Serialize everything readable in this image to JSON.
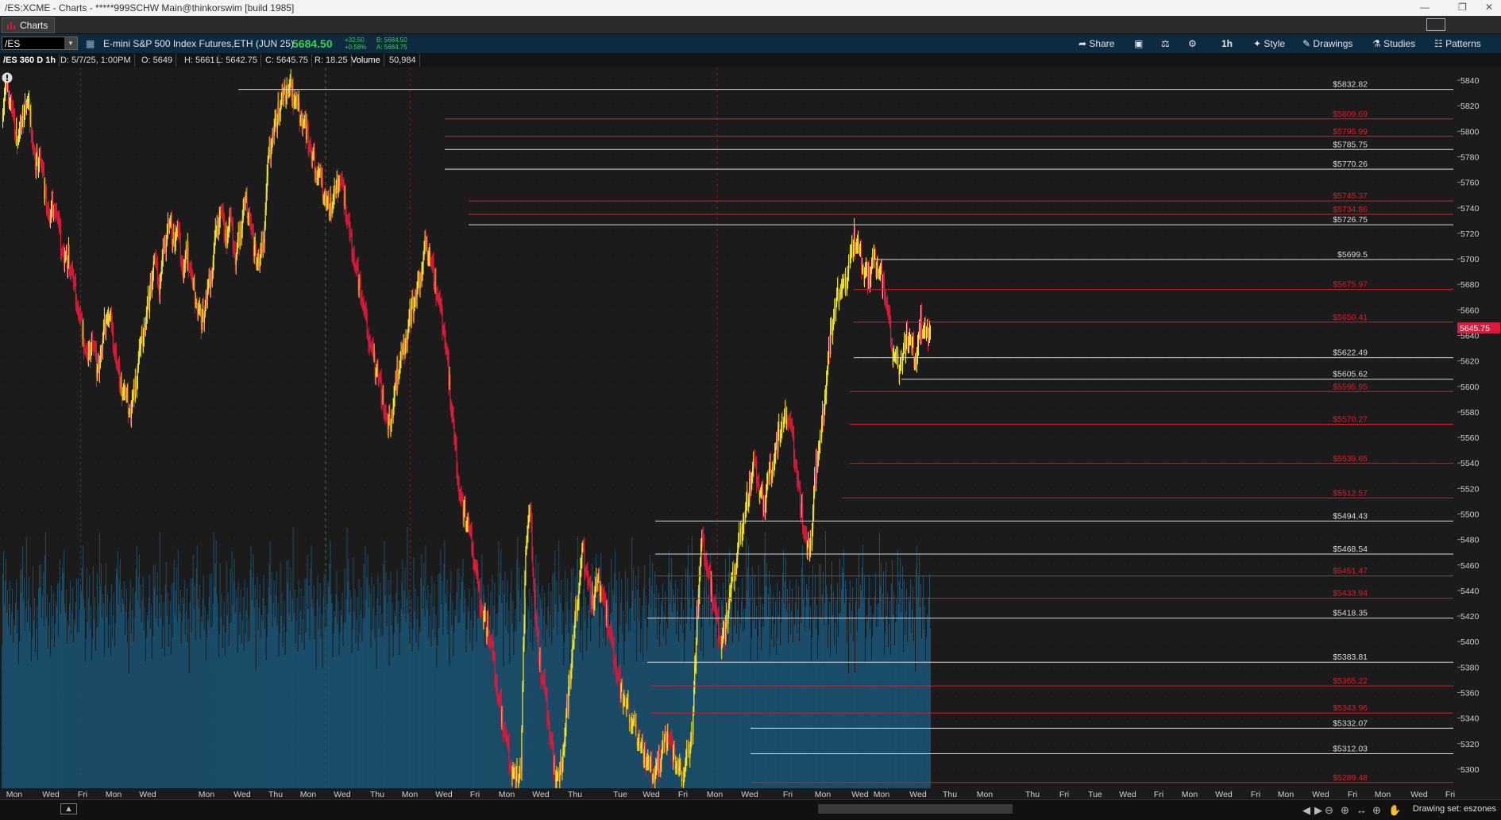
{
  "window": {
    "title": "/ES:XCME - Charts - *****999SCHW Main@thinkorswim [build 1985]"
  },
  "tab": {
    "label": "Charts"
  },
  "toolbar": {
    "symbol": "/ES",
    "description": "E-mini S&P 500 Index Futures,ETH (JUN 25)",
    "last": "5684.50",
    "change": "+32.50",
    "change_pct": "+0.58%",
    "bid": "B: 5684.50",
    "ask": "A: 5684.75",
    "buttons": {
      "share": "Share",
      "interval": "1h",
      "style": "Style",
      "drawings": "Drawings",
      "studies": "Studies",
      "patterns": "Patterns"
    }
  },
  "infobar": {
    "name": "/ES 360 D 1h",
    "date": "D: 5/7/25, 1:00PM",
    "open": "O: 5649",
    "high": "H: 5661",
    "low": "L: 5642.75",
    "close": "C: 5645.75",
    "range": "R: 18.25",
    "volume_label": "Volume",
    "volume_value": "50,984"
  },
  "bottom": {
    "drawing_set": "Drawing set: eszones"
  },
  "colors": {
    "up": "#f2e92a",
    "down": "#e0183a",
    "volume": "#1a5a7e",
    "level_white": "#d8d8d8",
    "level_red": "#d2202c",
    "background": "#1b1b1b",
    "current_price": "#e0183a"
  },
  "chart_data": {
    "type": "candlestick",
    "symbol": "/ES",
    "interval": "1h",
    "ylim": [
      5285,
      5850
    ],
    "y_ticks": [
      5300,
      5320,
      5340,
      5360,
      5380,
      5400,
      5420,
      5440,
      5460,
      5480,
      5500,
      5520,
      5540,
      5560,
      5580,
      5600,
      5620,
      5640,
      5660,
      5680,
      5700,
      5720,
      5740,
      5760,
      5780,
      5800,
      5820,
      5840
    ],
    "x_labels": [
      "Mon",
      "Wed",
      "Fri",
      "Mon",
      "Wed",
      "Mon",
      "Wed",
      "Thu",
      "Mon",
      "Wed",
      "Thu",
      "Mon",
      "Wed",
      "Fri",
      "Mon",
      "Wed",
      "Thu",
      "Tue",
      "Wed",
      "Fri",
      "Mon",
      "Wed",
      "Fri",
      "Mon",
      "Wed",
      "Mon",
      "Wed",
      "Thu",
      "Mon",
      "Thu",
      "Fri",
      "Tue",
      "Wed",
      "Fri",
      "Mon",
      "Wed",
      "Fri",
      "Mon",
      "Wed",
      "Fri",
      "Mon",
      "Wed",
      "Fri"
    ],
    "current_price": "5645.75",
    "price_levels": [
      {
        "value": 5832.82,
        "label": "$5832.82",
        "color": "white"
      },
      {
        "value": 5809.69,
        "label": "$5809.69",
        "color": "red"
      },
      {
        "value": 5795.99,
        "label": "$5795.99",
        "color": "red"
      },
      {
        "value": 5785.75,
        "label": "$5785.75",
        "color": "white"
      },
      {
        "value": 5770.26,
        "label": "$5770.26",
        "color": "white"
      },
      {
        "value": 5745.37,
        "label": "$5745.37",
        "color": "red"
      },
      {
        "value": 5734.86,
        "label": "$5734.86",
        "color": "red"
      },
      {
        "value": 5726.75,
        "label": "$5726.75",
        "color": "white"
      },
      {
        "value": 5699.5,
        "label": "$5699.5",
        "color": "white"
      },
      {
        "value": 5675.97,
        "label": "$5675.97",
        "color": "red"
      },
      {
        "value": 5650.41,
        "label": "$5650.41",
        "color": "red"
      },
      {
        "value": 5622.49,
        "label": "$5622.49",
        "color": "white"
      },
      {
        "value": 5605.62,
        "label": "$5605.62",
        "color": "white"
      },
      {
        "value": 5595.95,
        "label": "$5595.95",
        "color": "red"
      },
      {
        "value": 5570.27,
        "label": "$5570.27",
        "color": "red"
      },
      {
        "value": 5539.65,
        "label": "$5539.65",
        "color": "red"
      },
      {
        "value": 5512.57,
        "label": "$5512.57",
        "color": "red"
      },
      {
        "value": 5494.43,
        "label": "$5494.43",
        "color": "white"
      },
      {
        "value": 5468.54,
        "label": "$5468.54",
        "color": "white"
      },
      {
        "value": 5451.47,
        "label": "$5451.47",
        "color": "red"
      },
      {
        "value": 5433.94,
        "label": "$5433.94",
        "color": "red"
      },
      {
        "value": 5418.35,
        "label": "$5418.35",
        "color": "white"
      },
      {
        "value": 5383.81,
        "label": "$5383.81",
        "color": "white"
      },
      {
        "value": 5365.22,
        "label": "$5365.22",
        "color": "red"
      },
      {
        "value": 5343.96,
        "label": "$5343.96",
        "color": "red"
      },
      {
        "value": 5332.07,
        "label": "$5332.07",
        "color": "white"
      },
      {
        "value": 5312.03,
        "label": "$5312.03",
        "color": "white"
      },
      {
        "value": 5289.48,
        "label": "$5289.48",
        "color": "red"
      }
    ],
    "price_path": [
      [
        5815,
        5835,
        5820,
        5795,
        5800,
        5825,
        5810,
        5770,
        5785,
        5750,
        5730,
        5745,
        5720,
        5700
      ],
      [
        5700,
        5680,
        5660,
        5640,
        5620,
        5640,
        5610,
        5630,
        5660,
        5645,
        5620,
        5600,
        5590,
        5580
      ],
      [
        5600,
        5630,
        5650,
        5670,
        5700,
        5680,
        5705,
        5730,
        5715,
        5720,
        5690,
        5705,
        5680,
        5665
      ],
      [
        5650,
        5670,
        5690,
        5720,
        5740,
        5715,
        5730,
        5700,
        5720,
        5745,
        5735,
        5705,
        5695,
        5720
      ],
      [
        5780,
        5800,
        5815,
        5825,
        5835,
        5830,
        5820,
        5810,
        5800,
        5780,
        5770,
        5760,
        5745,
        5740
      ],
      [
        5750,
        5765,
        5745,
        5720,
        5700,
        5680,
        5660,
        5640,
        5620,
        5610,
        5590,
        5565,
        5580,
        5610
      ],
      [
        5625,
        5640,
        5660,
        5670,
        5690,
        5710,
        5700,
        5680,
        5660,
        5640,
        5600,
        5560,
        5520,
        5500
      ],
      [
        5490,
        5470,
        5440,
        5420,
        5410,
        5390,
        5360,
        5340,
        5320,
        5300,
        5290,
        5300,
        5480,
        5500
      ],
      [
        5420,
        5380,
        5360,
        5330,
        5300,
        5290,
        5320,
        5360,
        5400,
        5440,
        5470,
        5450,
        5430,
        5445
      ],
      [
        5440,
        5420,
        5400,
        5380,
        5360,
        5350,
        5340,
        5330,
        5320,
        5310,
        5300,
        5295,
        5305,
        5320
      ],
      [
        5330,
        5310,
        5300,
        5295,
        5310,
        5330,
        5420,
        5480,
        5460,
        5440,
        5420,
        5400,
        5410,
        5440
      ],
      [
        5460,
        5480,
        5500,
        5520,
        5540,
        5520,
        5505,
        5530,
        5540,
        5560,
        5570,
        5580,
        5560,
        5530
      ],
      [
        5500,
        5470,
        5480,
        5540,
        5560,
        5600,
        5640,
        5660,
        5680,
        5675,
        5700,
        5715,
        5705,
        5690
      ],
      [
        5685,
        5700,
        5695,
        5680,
        5660,
        5630,
        5615,
        5620,
        5640,
        5630,
        5620,
        5650,
        5640,
        5645
      ]
    ]
  }
}
